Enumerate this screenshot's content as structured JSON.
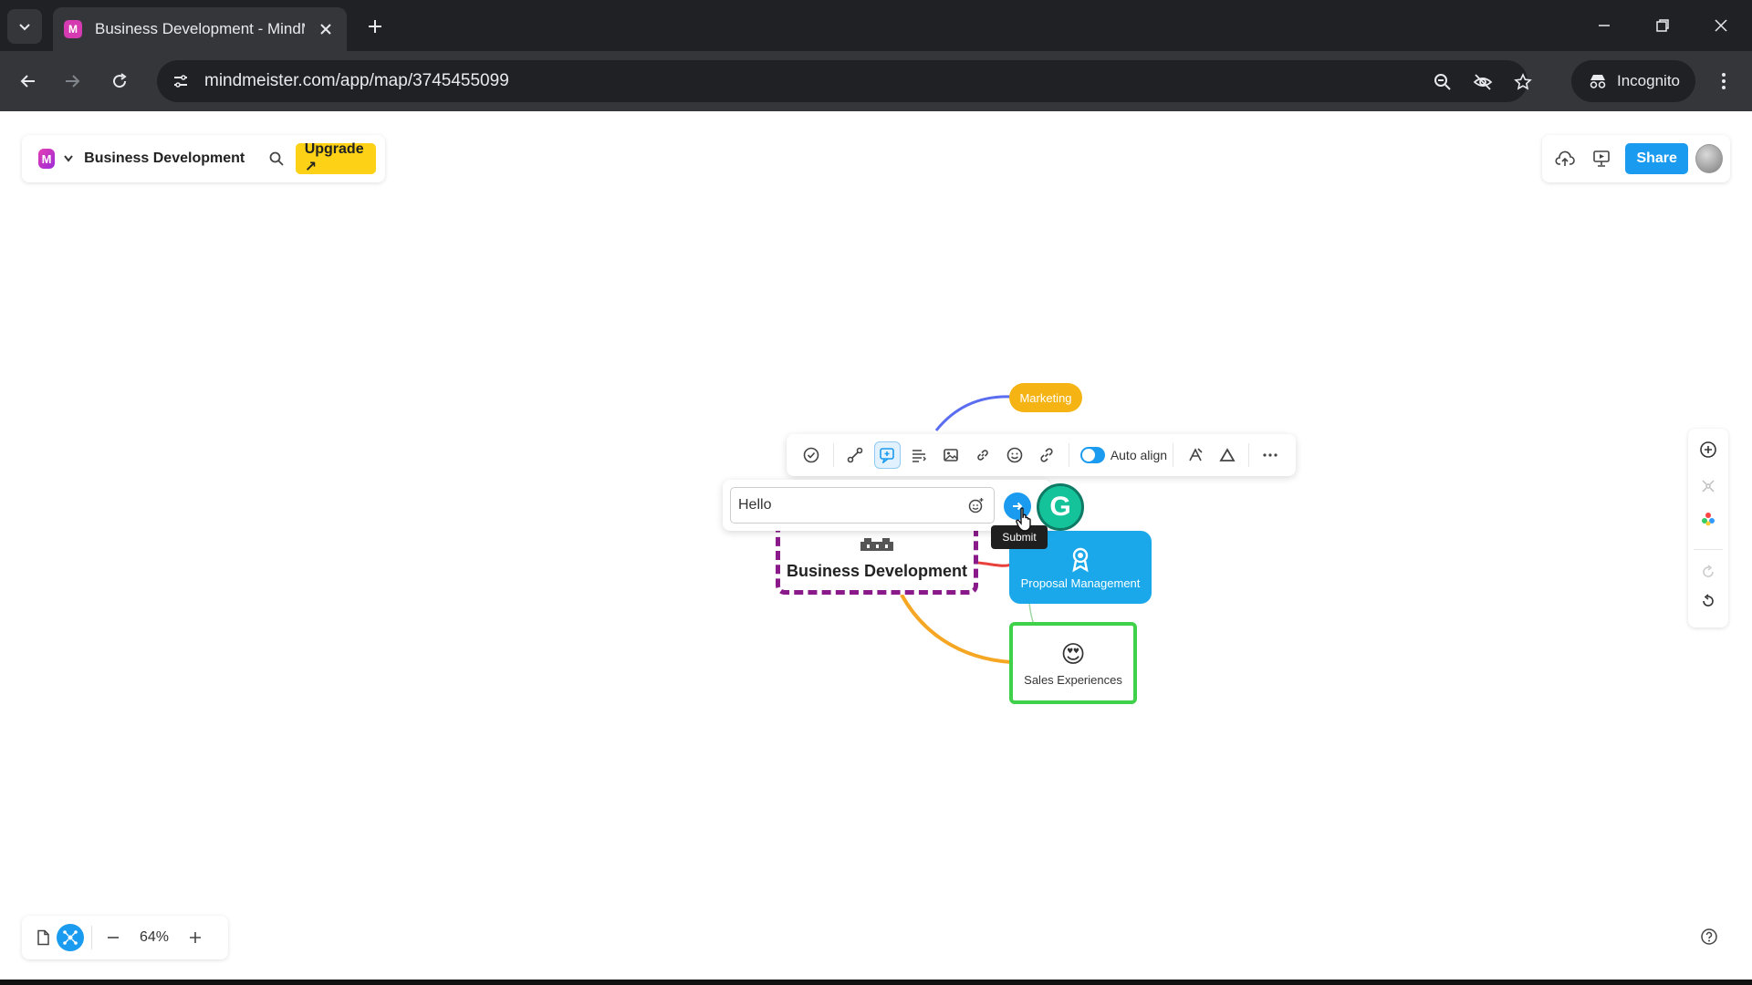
{
  "browser": {
    "tab_title": "Business Development - MindM",
    "url": "mindmeister.com/app/map/3745455099",
    "incognito_label": "Incognito",
    "favicon_letter": "M"
  },
  "app": {
    "logo_letter": "M",
    "map_title": "Business Development",
    "upgrade_label": "Upgrade ↗",
    "share_label": "Share",
    "zoom_level": "64%",
    "accent_color": "#1a9bf0"
  },
  "mindmap": {
    "root": "Business Development",
    "nodes": {
      "marketing": "Marketing",
      "proposal": "Proposal Management",
      "sales": "Sales Experiences",
      "sales_emoji": "😍"
    }
  },
  "node_toolbar": {
    "auto_align_label": "Auto align",
    "auto_align_on": true
  },
  "comment": {
    "input_value": "Hello",
    "submit_tooltip": "Submit"
  },
  "overlay": {
    "grammarly_letter": "G"
  }
}
